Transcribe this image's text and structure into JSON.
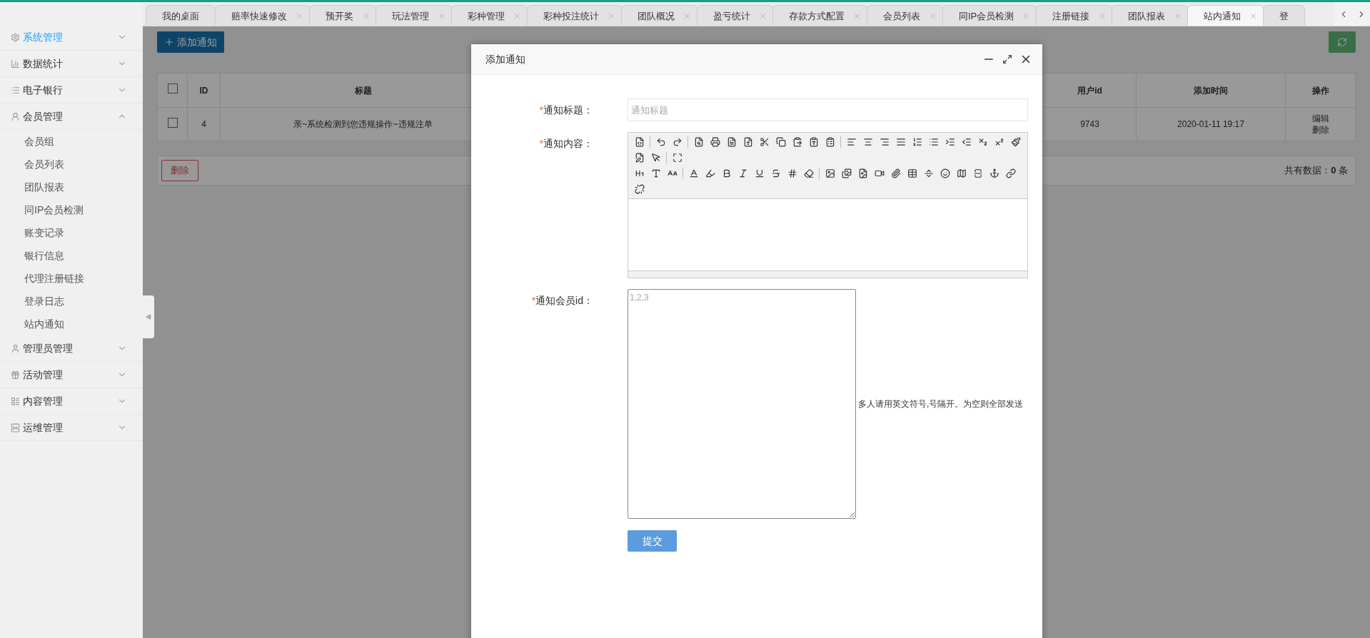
{
  "tabs": [
    {
      "label": "我的桌面",
      "selected": false,
      "closable": false
    },
    {
      "label": "赔率快速修改",
      "selected": false,
      "closable": true
    },
    {
      "label": "预开奖",
      "selected": false,
      "closable": true
    },
    {
      "label": "玩法管理",
      "selected": false,
      "closable": true
    },
    {
      "label": "彩种管理",
      "selected": false,
      "closable": true
    },
    {
      "label": "彩种投注统计",
      "selected": false,
      "closable": true
    },
    {
      "label": "团队概况",
      "selected": false,
      "closable": true
    },
    {
      "label": "盈亏统计",
      "selected": false,
      "closable": true
    },
    {
      "label": "存款方式配置",
      "selected": false,
      "closable": true
    },
    {
      "label": "会员列表",
      "selected": false,
      "closable": true
    },
    {
      "label": "同IP会员检测",
      "selected": false,
      "closable": true
    },
    {
      "label": "注册链接",
      "selected": false,
      "closable": true
    },
    {
      "label": "团队报表",
      "selected": false,
      "closable": true
    },
    {
      "label": "站内通知",
      "selected": true,
      "closable": true
    },
    {
      "label": "登",
      "selected": false,
      "closable": false
    }
  ],
  "sidebar": {
    "items": [
      {
        "label": "系统管理",
        "selected": true,
        "expanded": false
      },
      {
        "label": "数据统计",
        "selected": false,
        "expanded": false
      },
      {
        "label": "电子银行",
        "selected": false,
        "expanded": false
      },
      {
        "label": "会员管理",
        "selected": false,
        "expanded": true,
        "children": [
          {
            "label": "会员组"
          },
          {
            "label": "会员列表"
          },
          {
            "label": "团队报表"
          },
          {
            "label": "同IP会员检测"
          },
          {
            "label": "账变记录"
          },
          {
            "label": "银行信息"
          },
          {
            "label": "代理注册链接"
          },
          {
            "label": "登录日志"
          },
          {
            "label": "站内通知"
          }
        ]
      },
      {
        "label": "管理员管理",
        "selected": false,
        "expanded": false
      },
      {
        "label": "活动管理",
        "selected": false,
        "expanded": false
      },
      {
        "label": "内容管理",
        "selected": false,
        "expanded": false
      },
      {
        "label": "运维管理",
        "selected": false,
        "expanded": false
      }
    ]
  },
  "toolbar": {
    "add_button": "添加通知"
  },
  "table": {
    "header_checked": false,
    "columns": [
      "ID",
      "标题",
      "用户id",
      "添加时间",
      "操作"
    ],
    "rows": [
      {
        "checked": false,
        "id": "4",
        "title": "亲~系统检测到您违规操作~违规注单",
        "user_id": "9743",
        "time": "2020-01-11 19:17",
        "actions": [
          "编辑",
          "删除"
        ]
      }
    ]
  },
  "footer": {
    "delete_button": "删除",
    "total": "共有数据：**0** 条"
  },
  "modal": {
    "title": "添加通知",
    "fields": [
      {
        "kind": "input",
        "label": "通知标题：",
        "required_mark": "*",
        "placeholder": "通知标题"
      },
      {
        "kind": "editor",
        "label": "通知内容：",
        "required_mark": "*"
      },
      {
        "kind": "textarea",
        "label": "通知会员id：",
        "required_mark": "*",
        "placeholder": "1,2,3",
        "hint": "多人请用英文符号,号隔开。为空则全部发送"
      }
    ],
    "submit": "提交"
  }
}
